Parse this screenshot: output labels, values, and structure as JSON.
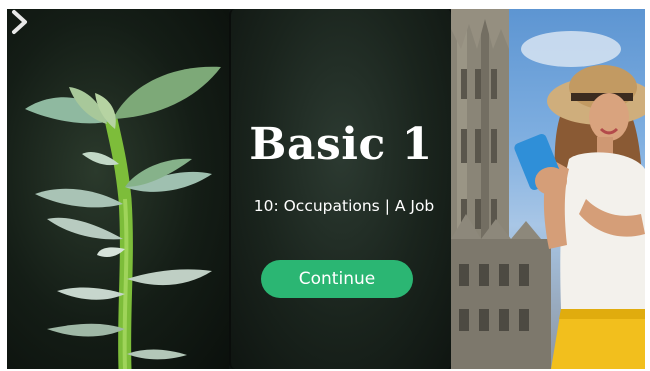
{
  "lesson": {
    "title": "Basic 1",
    "subtitle": "10: Occupations | A Job",
    "continue_label": "Continue"
  },
  "colors": {
    "accent_green": "#2bb673",
    "panel_dark": "#1a241d"
  },
  "icons": {
    "next": "chevron-right-icon"
  }
}
